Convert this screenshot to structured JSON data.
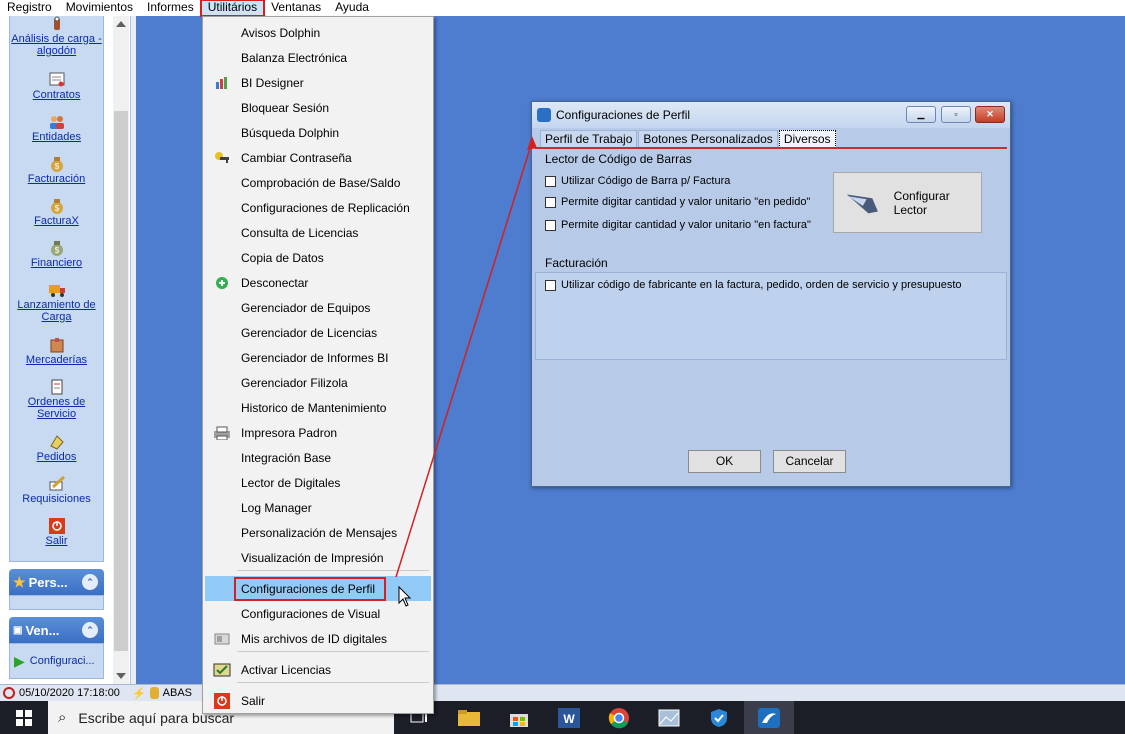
{
  "menubar": {
    "items": [
      "Registro",
      "Movimientos",
      "Informes",
      "Utilitários",
      "Ventanas",
      "Ayuda"
    ],
    "active": "Utilitários"
  },
  "sidebar": {
    "items": [
      {
        "label": "Análisis de carga - algodón",
        "icon": "cotton-icon"
      },
      {
        "label": "Contratos",
        "icon": "contract-icon"
      },
      {
        "label": "Entidades",
        "icon": "people-icon"
      },
      {
        "label": "Facturación",
        "icon": "money-bag-icon"
      },
      {
        "label": "FacturaX",
        "icon": "money-bag-icon"
      },
      {
        "label": "Financiero",
        "icon": "money-bag-icon"
      },
      {
        "label": "Lanzamiento de Carga",
        "icon": "truck-icon"
      },
      {
        "label": "Mercaderías",
        "icon": "box-icon"
      },
      {
        "label": "Ordenes de Servicio",
        "icon": "document-icon"
      },
      {
        "label": "Pedidos",
        "icon": "order-icon"
      },
      {
        "label": "Requisiciones",
        "icon": "pencil-icon"
      },
      {
        "label": "Salir",
        "icon": "exit-icon"
      }
    ],
    "section_pers": "Pers...",
    "section_ven": "Ven...",
    "ven_item": "Configuraci..."
  },
  "dropdown": {
    "items": [
      "Avisos Dolphin",
      "Balanza Electrónica",
      "BI Designer",
      "Bloquear Sesión",
      "Búsqueda Dolphin",
      "Cambiar Contraseña",
      "Comprobación de Base/Saldo",
      "Configuraciones de Replicación",
      "Consulta de Licencias",
      "Copia de Datos",
      "Desconectar",
      "Gerenciador de Equipos",
      "Gerenciador de Licencias",
      "Gerenciador de Informes BI",
      "Gerenciador Filizola",
      "Historico de Mantenimiento",
      "Impresora Padron",
      "Integración Base",
      "Lector de Digitales",
      "Log Manager",
      "Personalización de Mensajes",
      "Visualización de Impresión",
      "Configuraciones de Perfil",
      "Configuraciones de Visual",
      "Mis archivos de ID digitales",
      "Activar Licencias",
      "Salir"
    ],
    "highlighted": "Configuraciones de Perfil"
  },
  "dialog": {
    "title": "Configuraciones de Perfil",
    "tabs": [
      "Perfil de Trabajo",
      "Botones Personalizados",
      "Diversos"
    ],
    "active_tab": "Diversos",
    "group1_title": "Lector de Código de Barras",
    "group1_checks": [
      "Utilizar Código de Barra p/ Factura",
      "Permite digitar cantidad y valor unitario \"en pedido\"",
      "Permite digitar cantidad y valor unitario \"en factura\""
    ],
    "config_button": "Configurar Lector",
    "group2_title": "Facturación",
    "group2_checks": [
      "Utilizar código de fabricante en la factura, pedido, orden de servicio y presupuesto"
    ],
    "ok": "OK",
    "cancel": "Cancelar"
  },
  "statusbar": {
    "datetime": "05/10/2020 17:18:00",
    "db": "ABAS"
  },
  "taskbar": {
    "search_placeholder": "Escribe aquí para buscar"
  },
  "colors": {
    "desktop": "#4e7ccf",
    "highlight_red": "#d42020",
    "menu_highlight": "#91c9f7"
  }
}
